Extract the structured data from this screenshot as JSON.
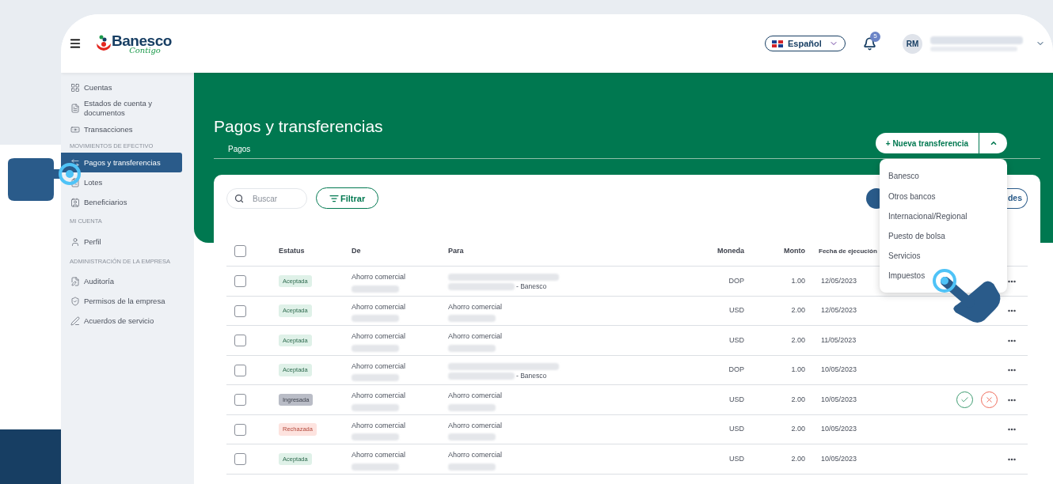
{
  "header": {
    "logo": {
      "name": "Banesco",
      "tagline": "Contigo"
    },
    "language": "Español",
    "notifications": "5",
    "user": {
      "initials": "RM"
    }
  },
  "sidebar": {
    "sections": [
      {
        "items": [
          {
            "label": "Cuentas",
            "selected": false
          },
          {
            "label": "Estados de cuenta y documentos",
            "selected": false
          },
          {
            "label": "Transacciones",
            "selected": false
          }
        ]
      },
      {
        "title": "MOVIMIENTOS DE EFECTIVO",
        "items": [
          {
            "label": "Pagos y transferencias",
            "selected": true
          },
          {
            "label": "Lotes",
            "selected": false
          },
          {
            "label": "Beneficiarios",
            "selected": false
          }
        ]
      },
      {
        "title": "MI CUENTA",
        "items": [
          {
            "label": "Perfil",
            "selected": false
          }
        ]
      },
      {
        "title": "ADMINISTRACIÓN DE LA EMPRESA",
        "items": [
          {
            "label": "Auditoría",
            "selected": false
          },
          {
            "label": "Permisos de la empresa",
            "selected": false
          },
          {
            "label": "Acuerdos de servicio",
            "selected": false
          }
        ]
      }
    ]
  },
  "page": {
    "title": "Pagos y transferencias",
    "tabs": [
      {
        "label": "Pagos",
        "selected": true
      }
    ],
    "new_button": {
      "label": "+ Nueva transferencia",
      "expanded": true
    },
    "menu": [
      "Banesco",
      "Otros bancos",
      "Internacional/Regional",
      "Puesto de bolsa",
      "Servicios",
      "Impuestos"
    ]
  },
  "toolbar": {
    "search_placeholder": "Buscar",
    "filter": "Filtrar",
    "right_button": "des"
  },
  "table": {
    "select_all": false,
    "columns": [
      "Estatus",
      "De",
      "Para",
      "Moneda",
      "Monto",
      "Fecha de ejecución"
    ],
    "rows": [
      {
        "checked": false,
        "status": {
          "kind": "accepted",
          "label": "Aceptada"
        },
        "from": "Ahorro comercial",
        "to": null,
        "to_bank": "- Banesco",
        "currency": "DOP",
        "amount": "1.00",
        "date": "12/05/2023"
      },
      {
        "checked": false,
        "status": {
          "kind": "accepted",
          "label": "Aceptada"
        },
        "from": "Ahorro comercial",
        "to": "Ahorro comercial",
        "to_bank": null,
        "currency": "USD",
        "amount": "2.00",
        "date": "12/05/2023",
        "approval": false
      },
      {
        "checked": false,
        "status": {
          "kind": "accepted",
          "label": "Aceptada"
        },
        "from": "Ahorro comercial",
        "to": "Ahorro comercial",
        "to_bank": null,
        "currency": "USD",
        "amount": "2.00",
        "date": "11/05/2023",
        "approval": false
      },
      {
        "checked": false,
        "status": {
          "kind": "accepted",
          "label": "Aceptada"
        },
        "from": "Ahorro comercial",
        "to": null,
        "to_bank": "- Banesco",
        "currency": "DOP",
        "amount": "1.00",
        "date": "10/05/2023",
        "approval": false
      },
      {
        "checked": false,
        "status": {
          "kind": "entered",
          "label": "Ingresada"
        },
        "from": "Ahorro comercial",
        "to": "Ahorro comercial",
        "to_bank": null,
        "currency": "USD",
        "amount": "2.00",
        "date": "10/05/2023",
        "approval": true
      },
      {
        "checked": false,
        "status": {
          "kind": "rejected",
          "label": "Rechazada"
        },
        "from": "Ahorro comercial",
        "to": "Ahorro comercial",
        "to_bank": null,
        "currency": "USD",
        "amount": "2.00",
        "date": "10/05/2023",
        "approval": false
      },
      {
        "checked": false,
        "status": {
          "kind": "accepted",
          "label": "Aceptada"
        },
        "from": "Ahorro comercial",
        "to": "Ahorro comercial",
        "to_bank": null,
        "currency": "USD",
        "amount": "2.00",
        "date": "10/05/2023",
        "approval": false
      }
    ]
  }
}
